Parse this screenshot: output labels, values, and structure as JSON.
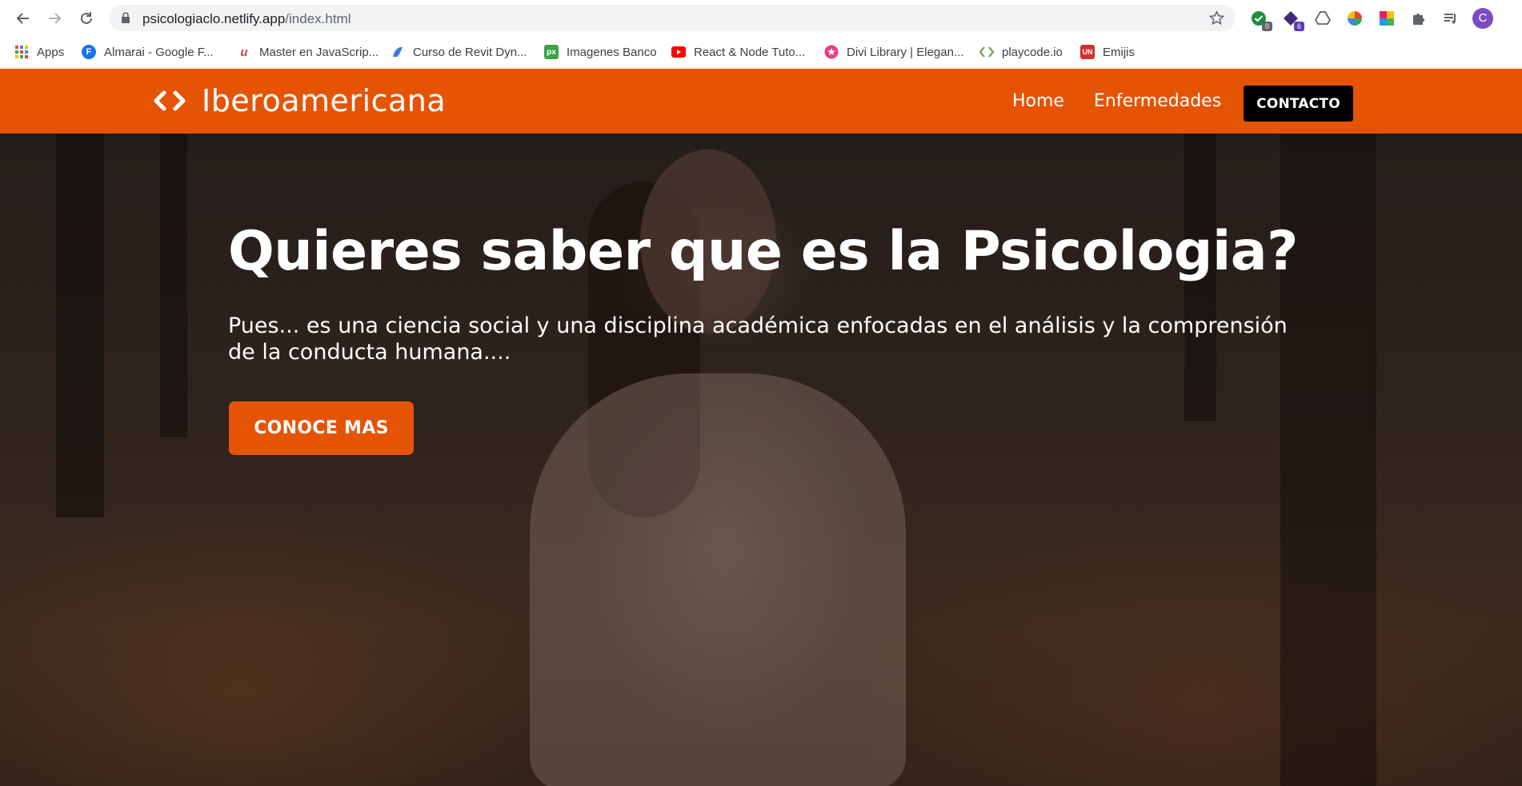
{
  "browser": {
    "url_domain": "psicologiaclo.netlify.app",
    "url_path": "/index.html",
    "extensions": [
      {
        "name": "check-extension-icon",
        "badge": "0",
        "color": "#1e8e3e"
      },
      {
        "name": "diamond-extension-icon",
        "badge": "6",
        "color": "#3f2a7a"
      },
      {
        "name": "drive-extension-icon",
        "badge": "",
        "color": "#5f6368"
      },
      {
        "name": "color-wheel-extension-icon",
        "badge": "",
        "color": "#e94235"
      },
      {
        "name": "palette-extension-icon",
        "badge": "",
        "color": "#8e24aa"
      }
    ],
    "profile_initial": "C"
  },
  "bookmarks": {
    "apps_label": "Apps",
    "items": [
      {
        "label": "Almarai - Google F...",
        "icon": "F",
        "color": "#1a73e8"
      },
      {
        "label": "Master en JavaScrip...",
        "icon": "u",
        "color": "#ffffff"
      },
      {
        "label": "Curso de Revit Dyn...",
        "icon": "",
        "color": "#ffffff"
      },
      {
        "label": "Imagenes Banco",
        "icon": "px",
        "color": "#3aa346"
      },
      {
        "label": "React & Node Tuto...",
        "icon": "",
        "color": "#ff0000"
      },
      {
        "label": "Divi Library | Elegan...",
        "icon": "",
        "color": "#e83e8c"
      },
      {
        "label": "playcode.io",
        "icon": "",
        "color": "#ffffff"
      },
      {
        "label": "Emijis",
        "icon": "UN",
        "color": "#d32f2f"
      }
    ]
  },
  "site": {
    "brand": "Iberoamericana",
    "nav": {
      "home": "Home",
      "diseases": "Enfermedades",
      "contact": "CONTACTO"
    },
    "hero": {
      "title": "Quieres saber que es la Psicologia?",
      "text": "Pues... es una ciencia social y una disciplina académica enfocadas en el análisis y la comprensión de la conducta humana....",
      "cta": "CONOCE MAS"
    },
    "colors": {
      "accent": "#e55405",
      "contact_bg": "#000000"
    }
  }
}
